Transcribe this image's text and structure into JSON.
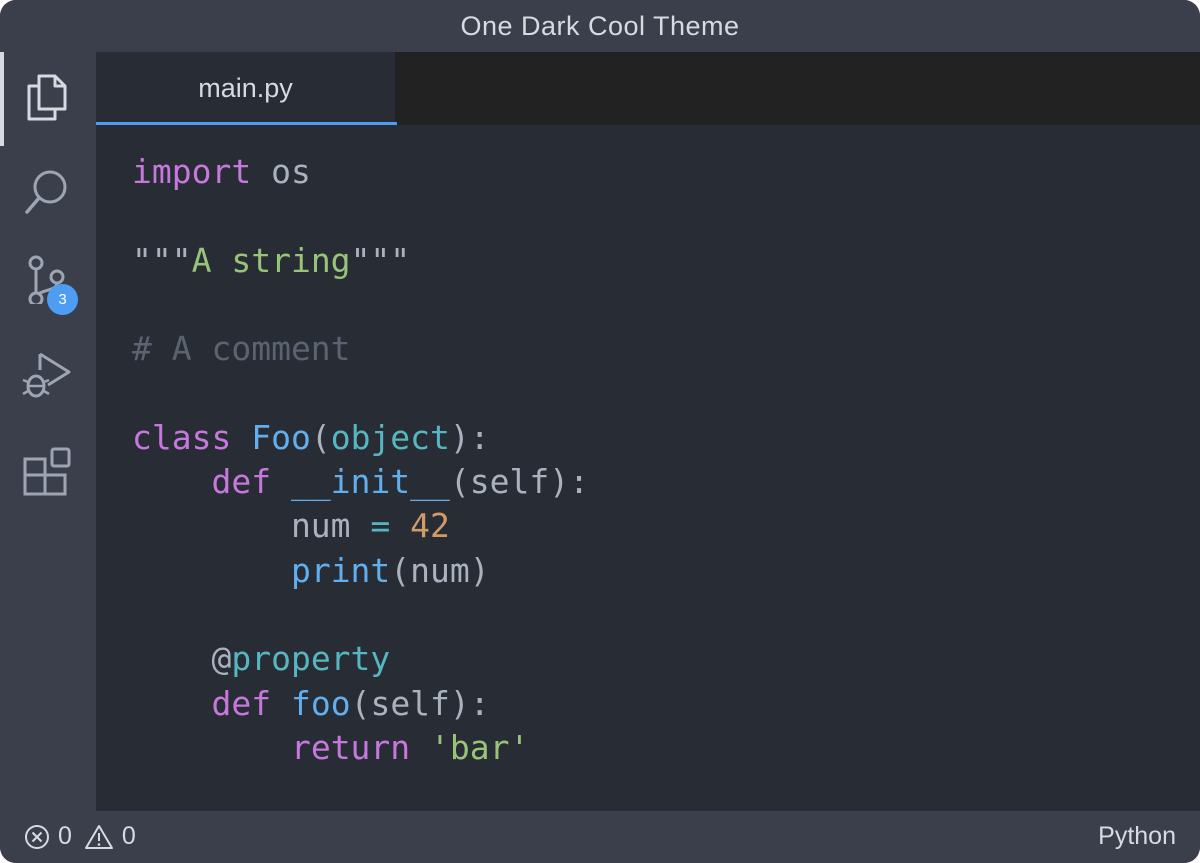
{
  "window": {
    "title": "One Dark Cool Theme"
  },
  "sidebar": {
    "items": [
      {
        "name": "explorer",
        "icon": "files-icon",
        "active": true
      },
      {
        "name": "search",
        "icon": "search-icon",
        "active": false
      },
      {
        "name": "source-control",
        "icon": "source-control-icon",
        "badge": "3",
        "active": false
      },
      {
        "name": "run-debug",
        "icon": "run-debug-icon",
        "active": false
      },
      {
        "name": "extensions",
        "icon": "extensions-icon",
        "active": false
      }
    ]
  },
  "tabs": [
    {
      "label": "main.py",
      "active": true
    }
  ],
  "editor": {
    "language": "python",
    "lines": [
      [
        {
          "t": "import",
          "c": "kw"
        },
        {
          "t": " os",
          "c": "plain"
        }
      ],
      [],
      [
        {
          "t": "\"\"\"",
          "c": "plain"
        },
        {
          "t": "A string",
          "c": "str"
        },
        {
          "t": "\"\"\"",
          "c": "plain"
        }
      ],
      [],
      [
        {
          "t": "# A comment",
          "c": "cmt"
        }
      ],
      [],
      [
        {
          "t": "class",
          "c": "kw"
        },
        {
          "t": " ",
          "c": "plain"
        },
        {
          "t": "Foo",
          "c": "cls"
        },
        {
          "t": "(",
          "c": "plain"
        },
        {
          "t": "object",
          "c": "bi"
        },
        {
          "t": "):",
          "c": "plain"
        }
      ],
      [
        {
          "t": "    ",
          "c": "plain"
        },
        {
          "t": "def",
          "c": "kw"
        },
        {
          "t": " ",
          "c": "plain"
        },
        {
          "t": "__init__",
          "c": "fn"
        },
        {
          "t": "(self):",
          "c": "plain"
        }
      ],
      [
        {
          "t": "        num ",
          "c": "plain"
        },
        {
          "t": "=",
          "c": "op"
        },
        {
          "t": " ",
          "c": "plain"
        },
        {
          "t": "42",
          "c": "num"
        }
      ],
      [
        {
          "t": "        ",
          "c": "plain"
        },
        {
          "t": "print",
          "c": "fn"
        },
        {
          "t": "(num)",
          "c": "plain"
        }
      ],
      [],
      [
        {
          "t": "    @",
          "c": "plain"
        },
        {
          "t": "property",
          "c": "bi"
        }
      ],
      [
        {
          "t": "    ",
          "c": "plain"
        },
        {
          "t": "def",
          "c": "kw"
        },
        {
          "t": " ",
          "c": "plain"
        },
        {
          "t": "foo",
          "c": "fn"
        },
        {
          "t": "(self):",
          "c": "plain"
        }
      ],
      [
        {
          "t": "        ",
          "c": "plain"
        },
        {
          "t": "return",
          "c": "kw"
        },
        {
          "t": " ",
          "c": "plain"
        },
        {
          "t": "'bar'",
          "c": "str"
        }
      ]
    ]
  },
  "status": {
    "errors": "0",
    "warnings": "0",
    "language": "Python",
    "error_icon": "error-circle-icon",
    "warning_icon": "warning-triangle-icon"
  },
  "colors": {
    "background": "#282c34",
    "chrome": "#3a3f4b",
    "accent": "#4d9df2",
    "keyword": "#c678dd",
    "string": "#98c379",
    "comment": "#5c6370",
    "function": "#61afef",
    "builtin": "#56b6c2",
    "number": "#d19a66"
  }
}
